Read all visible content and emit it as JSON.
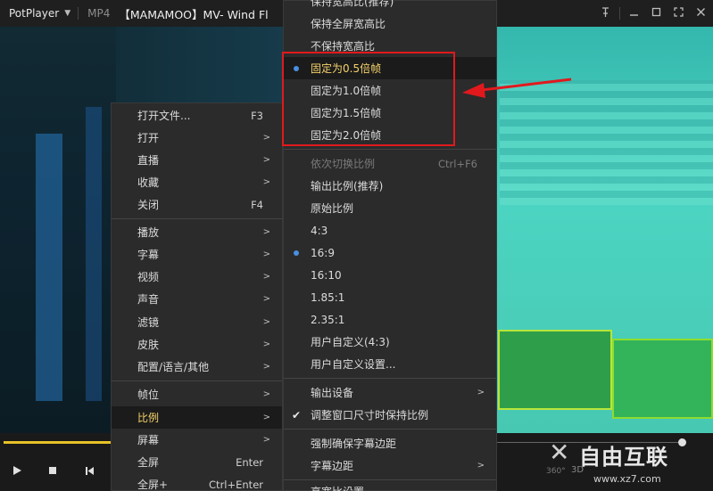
{
  "titlebar": {
    "app_name": "PotPlayer",
    "format": "MP4",
    "title": "【MAMAMOO】MV- Wind Fl",
    "icons": [
      "pin-icon",
      "minimize-icon",
      "maximize-icon",
      "fullscreen-icon",
      "close-icon"
    ]
  },
  "main_menu": {
    "items": [
      {
        "label": "打开文件...",
        "shortcut": "F3"
      },
      {
        "label": "打开",
        "arrow": ">"
      },
      {
        "label": "直播",
        "arrow": ">"
      },
      {
        "label": "收藏",
        "arrow": ">"
      },
      {
        "label": "关闭",
        "shortcut": "F4"
      },
      {
        "label": "播放",
        "arrow": ">"
      },
      {
        "label": "字幕",
        "arrow": ">"
      },
      {
        "label": "视频",
        "arrow": ">"
      },
      {
        "label": "声音",
        "arrow": ">"
      },
      {
        "label": "滤镜",
        "arrow": ">"
      },
      {
        "label": "皮肤",
        "arrow": ">"
      },
      {
        "label": "配置/语言/其他",
        "arrow": ">"
      },
      {
        "label": "帧位",
        "arrow": ">"
      },
      {
        "label": "比例",
        "arrow": ">"
      },
      {
        "label": "屏幕",
        "arrow": ">"
      },
      {
        "label": "全屏",
        "shortcut": "Enter"
      },
      {
        "label": "全屏+",
        "shortcut": "Ctrl+Enter"
      }
    ]
  },
  "ratio_menu": {
    "items": [
      {
        "label": "保持宽高比(推荐)"
      },
      {
        "label": "保持全屏宽高比"
      },
      {
        "label": "不保持宽高比"
      },
      {
        "label": "固定为0.5倍帧"
      },
      {
        "label": "固定为1.0倍帧"
      },
      {
        "label": "固定为1.5倍帧"
      },
      {
        "label": "固定为2.0倍帧"
      },
      {
        "label": "依次切换比例",
        "shortcut": "Ctrl+F6"
      },
      {
        "label": "输出比例(推荐)"
      },
      {
        "label": "原始比例"
      },
      {
        "label": "4:3"
      },
      {
        "label": "16:9"
      },
      {
        "label": "16:10"
      },
      {
        "label": "1.85:1"
      },
      {
        "label": "2.35:1"
      },
      {
        "label": "用户自定义(4:3)"
      },
      {
        "label": "用户自定义设置..."
      },
      {
        "label": "输出设备",
        "arrow": ">"
      },
      {
        "label": "调整窗口尺寸时保持比例"
      },
      {
        "label": "强制确保字幕边距"
      },
      {
        "label": "字幕边距",
        "arrow": ">"
      },
      {
        "label": "高宽比设置..."
      }
    ]
  },
  "controls": {
    "badge_360": "360°",
    "badge_3d": "3D"
  },
  "watermark": {
    "text": "自由互联",
    "url": "www.xz7.com"
  },
  "colors": {
    "selected_text": "#f5d36a",
    "radio_dot": "#4a8fe0",
    "annotation": "#e1191d",
    "seek_progress": "#e7c227"
  }
}
